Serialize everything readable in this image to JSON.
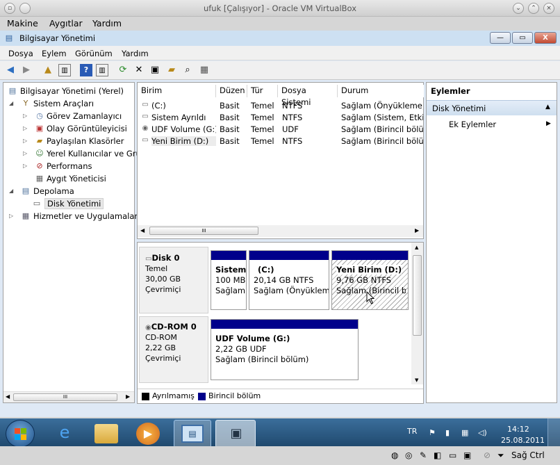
{
  "vbox": {
    "title": "ufuk [Çalışıyor] - Oracle VM VirtualBox",
    "menu": [
      "Makine",
      "Aygıtlar",
      "Yardım"
    ],
    "status_host_key": "Sağ Ctrl"
  },
  "mmc": {
    "title": "Bilgisayar Yönetimi",
    "menu": [
      "Dosya",
      "Eylem",
      "Görünüm",
      "Yardım"
    ],
    "controls": {
      "minimize": "—",
      "maximize": "▭",
      "close": "X"
    }
  },
  "tree": [
    {
      "label": "Bilgisayar Yönetimi (Yerel)",
      "icon": "computer-icon",
      "expander": ""
    },
    {
      "label": "Sistem Araçları",
      "icon": "tools-icon",
      "expander": "◢"
    },
    {
      "label": "Görev Zamanlayıcı",
      "icon": "clock-icon",
      "expander": "▷"
    },
    {
      "label": "Olay Görüntüleyicisi",
      "icon": "event-viewer-icon",
      "expander": "▷"
    },
    {
      "label": "Paylaşılan Klasörler",
      "icon": "shared-folder-icon",
      "expander": "▷"
    },
    {
      "label": "Yerel Kullanıcılar ve Gru",
      "icon": "users-icon",
      "expander": "▷"
    },
    {
      "label": "Performans",
      "icon": "performance-icon",
      "expander": "▷"
    },
    {
      "label": "Aygıt Yöneticisi",
      "icon": "device-manager-icon",
      "expander": ""
    },
    {
      "label": "Depolama",
      "icon": "storage-icon",
      "expander": "◢"
    },
    {
      "label": "Disk Yönetimi",
      "icon": "disk-management-icon",
      "expander": ""
    },
    {
      "label": "Hizmetler ve Uygulamalar",
      "icon": "services-icon",
      "expander": "▷"
    }
  ],
  "volumes": {
    "columns": [
      "Birim",
      "Düzen",
      "Tür",
      "Dosya Sistemi",
      "Durum"
    ],
    "rows": [
      [
        "(C:)",
        "Basit",
        "Temel",
        "NTFS",
        "Sağlam (Önyükleme, D"
      ],
      [
        "Sistem Ayrıldı",
        "Basit",
        "Temel",
        "NTFS",
        "Sağlam (Sistem, Etkin,"
      ],
      [
        "UDF Volume (G:)",
        "Basit",
        "Temel",
        "UDF",
        "Sağlam (Birincil bölüm"
      ],
      [
        "Yeni Birim (D:)",
        "Basit",
        "Temel",
        "NTFS",
        "Sağlam (Birincil bölüm"
      ]
    ],
    "scroll_grip": "III"
  },
  "disks": [
    {
      "name": "Disk 0",
      "type": "Temel",
      "size": "30,00 GB",
      "state": "Çevrimiçi",
      "partitions": [
        {
          "title": "Sistem",
          "line2": "100 MB",
          "line3": "Sağlam"
        },
        {
          "title": "(C:)",
          "line2": "20,14 GB NTFS",
          "line3": "Sağlam (Önyükleme"
        },
        {
          "title": "Yeni Birim  (D:)",
          "line2": "9,76 GB NTFS",
          "line3": "Sağlam (Birincil bö"
        }
      ]
    },
    {
      "name": "CD-ROM 0",
      "type": "CD-ROM",
      "size": "2,22 GB",
      "state": "Çevrimiçi",
      "partitions": [
        {
          "title": "UDF Volume  (G:)",
          "line2": "2,22 GB UDF",
          "line3": "Sağlam (Birincil bölüm)"
        }
      ]
    }
  ],
  "legend": [
    "Ayrılmamış",
    "Birincil bölüm"
  ],
  "actions": {
    "header": "Eylemler",
    "section": "Disk Yönetimi",
    "more": "Ek Eylemler"
  },
  "taskbar": {
    "lang": "TR",
    "time": "14:12",
    "date": "25.08.2011"
  },
  "colors": {
    "primary_partition": "#00008b",
    "unallocated": "#000000",
    "selection": "#c5dcf5"
  }
}
